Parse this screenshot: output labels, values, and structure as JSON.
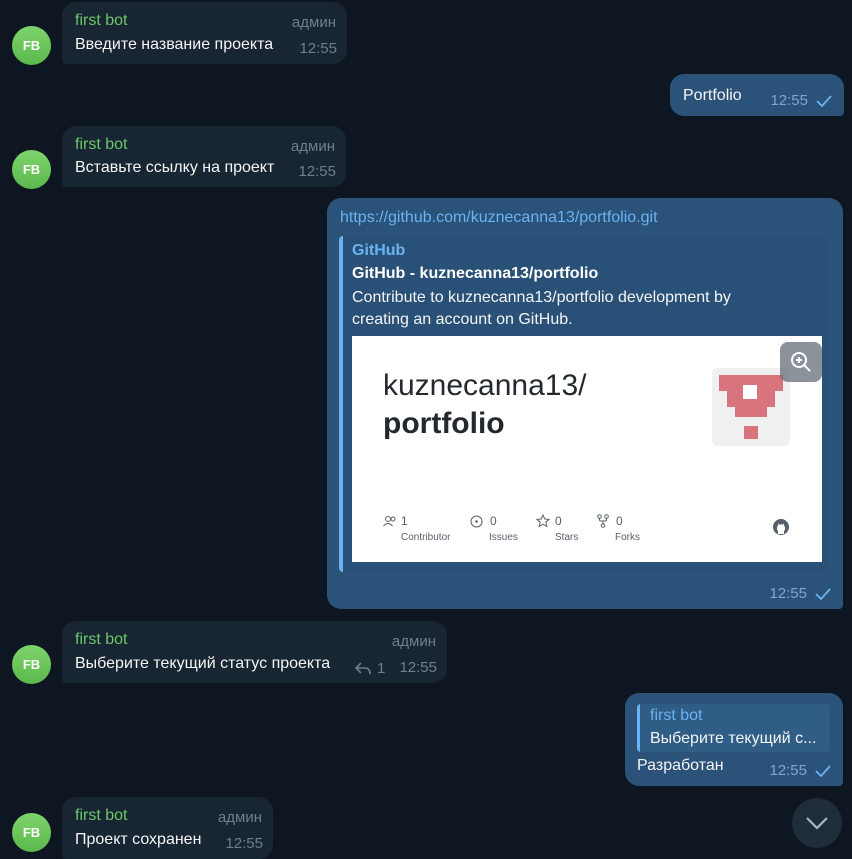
{
  "bot_initials": "FB",
  "messages": [
    {
      "sender": "first bot",
      "role": "админ",
      "text": "Введите название проекта",
      "time": "12:55"
    },
    {
      "out": true,
      "text": "Portfolio",
      "time": "12:55"
    },
    {
      "sender": "first bot",
      "role": "админ",
      "text": "Вставьте ссылку на проект",
      "time": "12:55"
    },
    {
      "out": true,
      "link": "https://github.com/kuznecanna13/portfolio.git",
      "time": "12:55",
      "preview": {
        "site": "GitHub",
        "title": "GitHub - kuznecanna13/portfolio",
        "description": "Contribute to kuznecanna13/portfolio development by creating an account on GitHub.",
        "card_owner": "kuznecanna13/",
        "card_repo": "portfolio",
        "stats": [
          {
            "value": "1",
            "label": "Contributor"
          },
          {
            "value": "0",
            "label": "Issues"
          },
          {
            "value": "0",
            "label": "Stars"
          },
          {
            "value": "0",
            "label": "Forks"
          }
        ]
      }
    },
    {
      "sender": "first bot",
      "role": "админ",
      "text": "Выберите текущий статус проекта",
      "time": "12:55",
      "replies": "1"
    },
    {
      "out": true,
      "reply_to": {
        "sender": "first bot",
        "text": "Выберите текущий с..."
      },
      "text": "Разработан",
      "time": "12:55"
    },
    {
      "sender": "first bot",
      "role": "админ",
      "text": "Проект сохранен",
      "time": "12:55"
    }
  ],
  "colors": {
    "background": "#0e1621",
    "incoming": "#182533",
    "outgoing": "#2b5278",
    "accent": "#6ab3f3",
    "sender": "#6dc768"
  }
}
